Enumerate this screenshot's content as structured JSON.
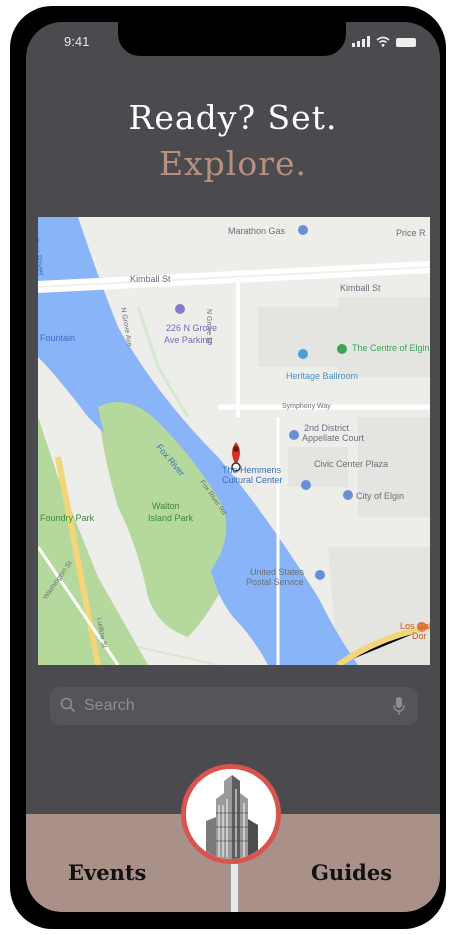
{
  "status_bar": {
    "time": "9:41"
  },
  "header": {
    "line1": "Ready? Set.",
    "line2": "Explore."
  },
  "map": {
    "labels": {
      "marathon": "Marathon Gas",
      "price": "Price R",
      "kimball_left": "Kimball St",
      "kimball_right": "Kimball St",
      "fox_river_top": "Fox River",
      "fountain": "Fountain",
      "parking_1": "226 N Grove",
      "parking_2": "Ave Parking",
      "centre": "The Centre of Elgin",
      "ballroom": "Heritage Ballroom",
      "symphony": "Symphony Way",
      "court_1": "2nd District",
      "court_2": "Appellate Court",
      "civic": "Civic Center Plaza",
      "hemmens_1": "The Hemmens",
      "hemmens_2": "Cultural Center",
      "city_of_elgin": "City of Elgin",
      "fox_river_mid": "Fox River",
      "foundry": "Foundry Park",
      "walton_1": "Walton",
      "walton_2": "Island Park",
      "river_rd": "Fox River Rd",
      "grove_ave": "N Grove Ave",
      "grove_st": "N Grove St",
      "usps_1": "United States",
      "usps_2": "Postal Service",
      "washington": "Washington St",
      "lucas": "Ludlow St",
      "los_1": "Los Gal",
      "los_2": "Dor"
    }
  },
  "search": {
    "placeholder": "Search"
  },
  "tabs": {
    "events": "Events",
    "guides": "Guides"
  },
  "colors": {
    "background": "#4a4a4f",
    "accent_text": "#b89080",
    "tab_bar": "#a99088",
    "button_ring": "#d9544f",
    "water": "#8ab4f8",
    "park": "#b5d99c"
  },
  "icons": [
    "signal-icon",
    "wifi-icon",
    "battery-icon",
    "search-icon",
    "microphone-icon",
    "map-pin-icon",
    "building-icon"
  ]
}
